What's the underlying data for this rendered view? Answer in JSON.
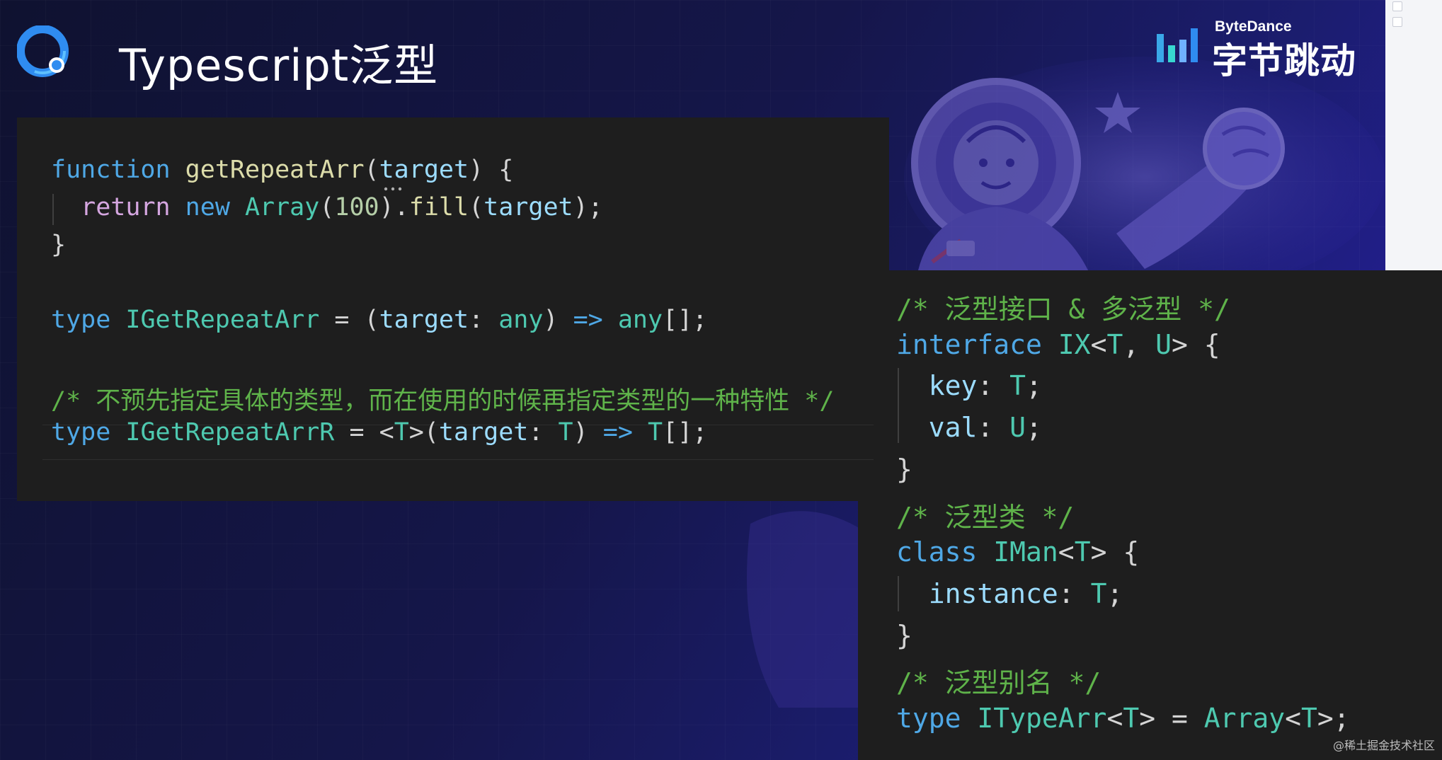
{
  "slide": {
    "title": "Typescript泛型",
    "brand": {
      "en": "ByteDance",
      "cn": "字节跳动"
    },
    "watermark": "@稀土掘金技术社区"
  },
  "colors": {
    "background": "#15164a",
    "code_bg": "#1e1e1e",
    "keyword": "#4fa8e6",
    "function": "#dcdcaa",
    "type": "#4ec9b0",
    "variable": "#9cdcfe",
    "number": "#b5cea8",
    "comment": "#5fb34a",
    "control": "#d5a6e0"
  },
  "icons": {
    "app_logo": "circular-q-logo-icon",
    "brand_logo": "bytedance-bars-icon"
  },
  "left_code": [
    [
      {
        "t": "function",
        "c": "kw"
      },
      {
        "t": " ",
        "c": "pun"
      },
      {
        "t": "getRepeatArr",
        "c": "fn"
      },
      {
        "t": "(",
        "c": "pun"
      },
      {
        "t": "target",
        "c": "var"
      },
      {
        "t": ") {",
        "c": "pun"
      }
    ],
    [
      {
        "t": "  ",
        "c": "pun"
      },
      {
        "t": "return",
        "c": "ret"
      },
      {
        "t": " ",
        "c": "pun"
      },
      {
        "t": "new",
        "c": "kw"
      },
      {
        "t": " ",
        "c": "pun"
      },
      {
        "t": "Array",
        "c": "typ"
      },
      {
        "t": "(",
        "c": "pun"
      },
      {
        "t": "100",
        "c": "num"
      },
      {
        "t": ").",
        "c": "pun"
      },
      {
        "t": "fill",
        "c": "fn"
      },
      {
        "t": "(",
        "c": "pun"
      },
      {
        "t": "target",
        "c": "var"
      },
      {
        "t": ");",
        "c": "pun"
      }
    ],
    [
      {
        "t": "}",
        "c": "pun"
      }
    ],
    [],
    [
      {
        "t": "type",
        "c": "kw"
      },
      {
        "t": " ",
        "c": "pun"
      },
      {
        "t": "IGetRepeatArr",
        "c": "typ"
      },
      {
        "t": " = (",
        "c": "pun"
      },
      {
        "t": "target",
        "c": "var"
      },
      {
        "t": ": ",
        "c": "pun"
      },
      {
        "t": "any",
        "c": "typ"
      },
      {
        "t": ") ",
        "c": "pun"
      },
      {
        "t": "=>",
        "c": "kw"
      },
      {
        "t": " ",
        "c": "pun"
      },
      {
        "t": "any",
        "c": "typ"
      },
      {
        "t": "[];",
        "c": "pun"
      }
    ],
    [],
    [
      {
        "t": "/* 不预先指定具体的类型，而在使用的时候再指定类型的一种特性 */",
        "c": "cmt"
      }
    ],
    [
      {
        "t": "type",
        "c": "kw"
      },
      {
        "t": " ",
        "c": "pun"
      },
      {
        "t": "IGetRepeatArrR",
        "c": "typ"
      },
      {
        "t": " = <",
        "c": "pun"
      },
      {
        "t": "T",
        "c": "tp"
      },
      {
        "t": ">(",
        "c": "pun"
      },
      {
        "t": "target",
        "c": "var"
      },
      {
        "t": ": ",
        "c": "pun"
      },
      {
        "t": "T",
        "c": "tp"
      },
      {
        "t": ") ",
        "c": "pun"
      },
      {
        "t": "=>",
        "c": "kw"
      },
      {
        "t": " ",
        "c": "pun"
      },
      {
        "t": "T",
        "c": "tp"
      },
      {
        "t": "[];",
        "c": "pun"
      }
    ]
  ],
  "right_code": [
    [
      {
        "t": "/* 泛型接口 & 多泛型 */",
        "c": "cmt"
      }
    ],
    [
      {
        "t": "interface",
        "c": "kw"
      },
      {
        "t": " ",
        "c": "pun"
      },
      {
        "t": "IX",
        "c": "typ"
      },
      {
        "t": "<",
        "c": "pun"
      },
      {
        "t": "T",
        "c": "tp"
      },
      {
        "t": ", ",
        "c": "pun"
      },
      {
        "t": "U",
        "c": "tp"
      },
      {
        "t": "> {",
        "c": "pun"
      }
    ],
    [
      {
        "t": "  ",
        "c": "pun"
      },
      {
        "t": "key",
        "c": "var"
      },
      {
        "t": ": ",
        "c": "pun"
      },
      {
        "t": "T",
        "c": "tp"
      },
      {
        "t": ";",
        "c": "pun"
      }
    ],
    [
      {
        "t": "  ",
        "c": "pun"
      },
      {
        "t": "val",
        "c": "var"
      },
      {
        "t": ": ",
        "c": "pun"
      },
      {
        "t": "U",
        "c": "tp"
      },
      {
        "t": ";",
        "c": "pun"
      }
    ],
    [
      {
        "t": "}",
        "c": "pun"
      }
    ],
    [
      {
        "t": "/* 泛型类 */",
        "c": "cmt"
      }
    ],
    [
      {
        "t": "class",
        "c": "kw"
      },
      {
        "t": " ",
        "c": "pun"
      },
      {
        "t": "IMan",
        "c": "typ"
      },
      {
        "t": "<",
        "c": "pun"
      },
      {
        "t": "T",
        "c": "tp"
      },
      {
        "t": "> {",
        "c": "pun"
      }
    ],
    [
      {
        "t": "  ",
        "c": "pun"
      },
      {
        "t": "instance",
        "c": "var"
      },
      {
        "t": ": ",
        "c": "pun"
      },
      {
        "t": "T",
        "c": "tp"
      },
      {
        "t": ";",
        "c": "pun"
      }
    ],
    [
      {
        "t": "}",
        "c": "pun"
      }
    ],
    [
      {
        "t": "/* 泛型别名 */",
        "c": "cmt"
      }
    ],
    [
      {
        "t": "type",
        "c": "kw"
      },
      {
        "t": " ",
        "c": "pun"
      },
      {
        "t": "ITypeArr",
        "c": "typ"
      },
      {
        "t": "<",
        "c": "pun"
      },
      {
        "t": "T",
        "c": "tp"
      },
      {
        "t": "> = ",
        "c": "pun"
      },
      {
        "t": "Array",
        "c": "typ"
      },
      {
        "t": "<",
        "c": "pun"
      },
      {
        "t": "T",
        "c": "tp"
      },
      {
        "t": ">;",
        "c": "pun"
      }
    ]
  ]
}
